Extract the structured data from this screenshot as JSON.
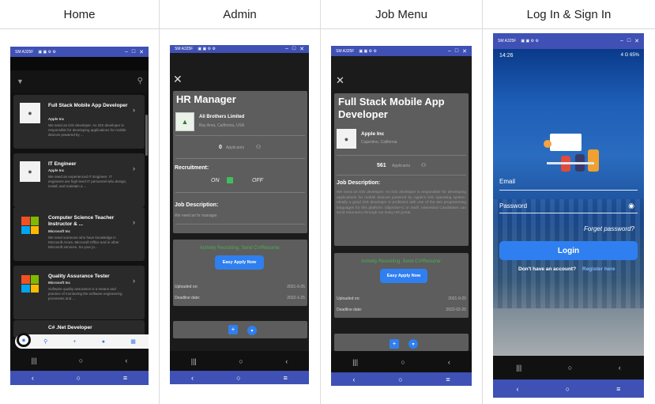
{
  "columns": [
    "Home",
    "Admin",
    "Job Menu",
    "Log In & Sign In"
  ],
  "status": {
    "device": "SM A325F",
    "time": "14:26",
    "battery": "4 G 65%"
  },
  "home": {
    "jobs": [
      {
        "title": "Full Stack Mobile App Developer",
        "company": "Apple Inc",
        "desc": "We need an iOS developer. An iOS developer is responsible for developing applications for mobile devices powered by ..."
      },
      {
        "title": "IT Engineer",
        "company": "Apple Inc",
        "desc": "We need an experienced IT Engineer. IT engineers are high level IT personnel who design, install, and maintain a ..."
      },
      {
        "title": "Computer Science Teacher Instructor & ...",
        "company": "Microsoft Inc",
        "desc": "We need someone who have knowledge in Microsoft Azure, Microsoft Office and in other Microsoft services. So your jo..."
      },
      {
        "title": "Quality Assurance Tester",
        "company": "Microsoft Inc",
        "desc": "Software quality assurance is a means and practice of monitoring the software engineering processes and ..."
      },
      {
        "title": "C# .Net Developer",
        "company": "",
        "desc": ""
      }
    ]
  },
  "admin": {
    "title": "HR Manager",
    "company": "Ali Brothers Limited",
    "location": "Bay Area, California, USA",
    "applicants_count": "0",
    "applicants_label": "Applicants",
    "recruitment_label": "Recruitment:",
    "on": "ON",
    "off": "OFF",
    "desc_label": "Job Description:",
    "desc": "We need an hr manager",
    "recruit_text": "Actively Recruiting. Send CV/Resume:",
    "apply_btn": "Easy Apply Now",
    "uploaded_label": "Uploaded on:",
    "uploaded": "2021-9-25",
    "deadline_label": "Deadline date:",
    "deadline": "2022-1-25"
  },
  "job": {
    "title": "Full Stack Mobile App Developer",
    "company": "Apple Inc",
    "location": "Cupertino, California",
    "applicants_count": "561",
    "applicants_label": "Applicants",
    "desc_label": "Job Description:",
    "desc": "We need an iOS developer. An iOS developer is responsible for developing applications for mobile devices powered by Apple's iOS operating system. Ideally a good iOS developer is proficient with one of the two programming languages for this platform: Objective-C or Swift. Interested Candidates can send resume/cv through our Easy HR portal.",
    "recruit_text": "Actively Recruiting. Send CV/Resume:",
    "apply_btn": "Easy Apply Now",
    "uploaded_label": "Uploaded on:",
    "uploaded": "2021-9-25",
    "deadline_label": "Deadline date:",
    "deadline": "2022-02-25"
  },
  "login": {
    "email_label": "Email",
    "password_label": "Password",
    "forgot": "Forget password?",
    "login_btn": "Login",
    "no_account": "Don't have an account?",
    "register": "Register here"
  },
  "colors": {
    "nav": "#3f51b5",
    "accent": "#2f7ff0",
    "card": "#2a2a2a",
    "panel": "#5d5d5d"
  }
}
